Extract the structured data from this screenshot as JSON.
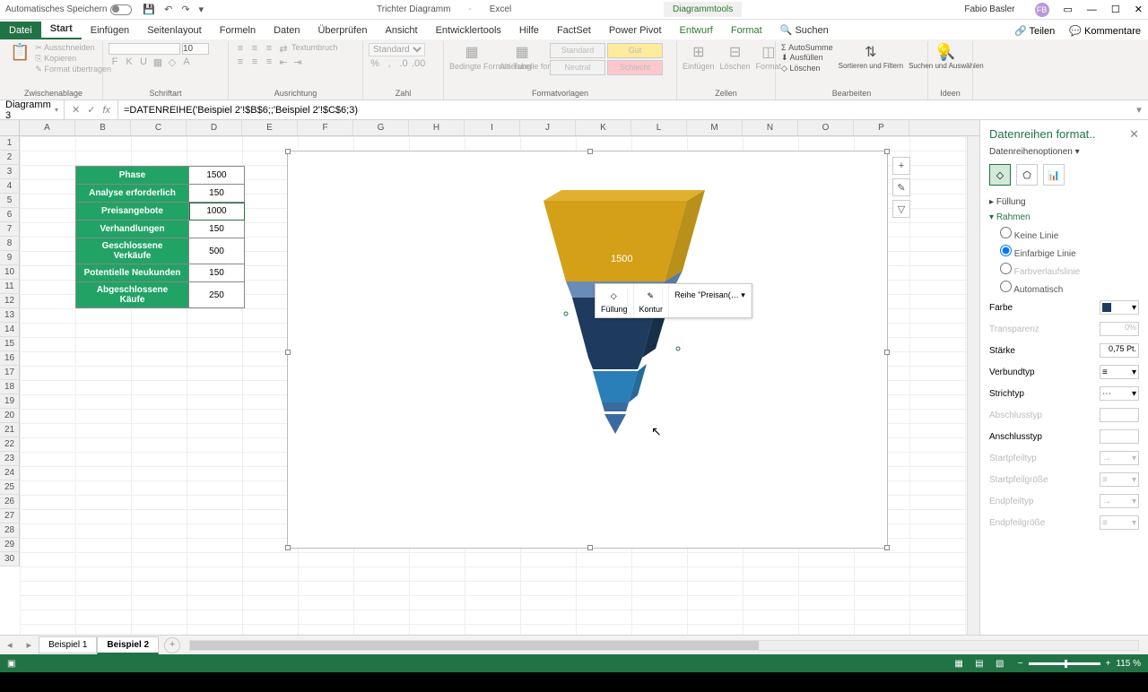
{
  "titlebar": {
    "autosave": "Automatisches Speichern",
    "doc": "Trichter Diagramm",
    "app": "Excel",
    "tools": "Diagrammtools",
    "user": "Fabio Basler",
    "user_initials": "FB"
  },
  "tabs": {
    "file": "Datei",
    "start": "Start",
    "insert": "Einfügen",
    "layout": "Seitenlayout",
    "formulas": "Formeln",
    "data": "Daten",
    "review": "Überprüfen",
    "view": "Ansicht",
    "dev": "Entwicklertools",
    "help": "Hilfe",
    "factset": "FactSet",
    "powerpivot": "Power Pivot",
    "design": "Entwurf",
    "format": "Format",
    "search": "Suchen",
    "share": "Teilen",
    "comments": "Kommentare"
  },
  "ribbon": {
    "clipboard": "Zwischenablage",
    "cut": "Ausschneiden",
    "copy": "Kopieren",
    "formatpainter": "Format übertragen",
    "font": "Schriftart",
    "fontsize": "10",
    "alignment": "Ausrichtung",
    "wrap": "Textumbruch",
    "number": "Zahl",
    "numberfmt": "Standard",
    "cond": "Bedingte Formatierung",
    "astable": "Als Tabelle formatieren",
    "styles": "Formatvorlagen",
    "std": "Standard",
    "neutral": "Neutral",
    "gut": "Gut",
    "schlecht": "Schlecht",
    "cells": "Zellen",
    "ins": "Einfügen",
    "del": "Löschen",
    "fmt": "Format",
    "editing": "Bearbeiten",
    "autosum": "AutoSumme",
    "fill": "Ausfüllen",
    "clear": "Löschen",
    "sort": "Sortieren und Filtern",
    "find": "Suchen und Auswählen",
    "ideas": "Ideen"
  },
  "formula": {
    "name": "Diagramm 3",
    "formula": "=DATENREIHE('Beispiel 2'!$B$6;;'Beispiel 2'!$C$6;3)"
  },
  "columns": [
    "A",
    "B",
    "C",
    "D",
    "E",
    "F",
    "G",
    "H",
    "I",
    "J",
    "K",
    "L",
    "M",
    "N",
    "O",
    "P"
  ],
  "table": {
    "h1": "Phase",
    "v1": "1500",
    "h2": "Analyse erforderlich",
    "v2": "150",
    "h3": "Preisangebote",
    "v3": "1000",
    "h4": "Verhandlungen",
    "v4": "150",
    "h5": "Geschlossene Verkäufe",
    "v5": "500",
    "h6": "Potentielle Neukunden",
    "v6": "150",
    "h7": "Abgeschlossene Käufe",
    "v7": "250"
  },
  "chart_data": {
    "type": "funnel-3d",
    "title": "",
    "categories": [
      "Phase",
      "Analyse erforderlich",
      "Preisangebote",
      "Verhandlungen",
      "Geschlossene Verkäufe",
      "Potentielle Neukunden",
      "Abgeschlossene Käufe"
    ],
    "values": [
      1500,
      150,
      1000,
      150,
      500,
      150,
      250
    ],
    "label_visible": "1500",
    "selected_series": "Preisangebote",
    "colors": [
      "#d4a017",
      "#6a8db8",
      "#1f3a5f",
      "#1f3a5f",
      "#2a7fb8",
      "#3a6a9f",
      "#3a6a9f"
    ]
  },
  "mini": {
    "fill": "Füllung",
    "outline": "Kontur",
    "series": "Reihe \"Preisan(…"
  },
  "pane": {
    "title": "Datenreihen format..",
    "sub": "Datenreihenoptionen",
    "s_fill": "Füllung",
    "s_border": "Rahmen",
    "noline": "Keine Linie",
    "solid": "Einfarbige Linie",
    "gradient": "Farbverlaufslinie",
    "auto": "Automatisch",
    "color": "Farbe",
    "transp": "Transparenz",
    "transp_v": "0%",
    "width": "Stärke",
    "width_v": "0,75 Pt.",
    "compound": "Verbundtyp",
    "dash": "Strichtyp",
    "cap": "Abschlusstyp",
    "join": "Anschlusstyp",
    "arrowbt": "Startpfeiltyp",
    "arrowbs": "Startpfeilgröße",
    "arrowet": "Endpfeiltyp",
    "arrowes": "Endpfeilgröße"
  },
  "sheets": {
    "s1": "Beispiel 1",
    "s2": "Beispiel 2"
  },
  "status": {
    "zoom": "115 %"
  }
}
